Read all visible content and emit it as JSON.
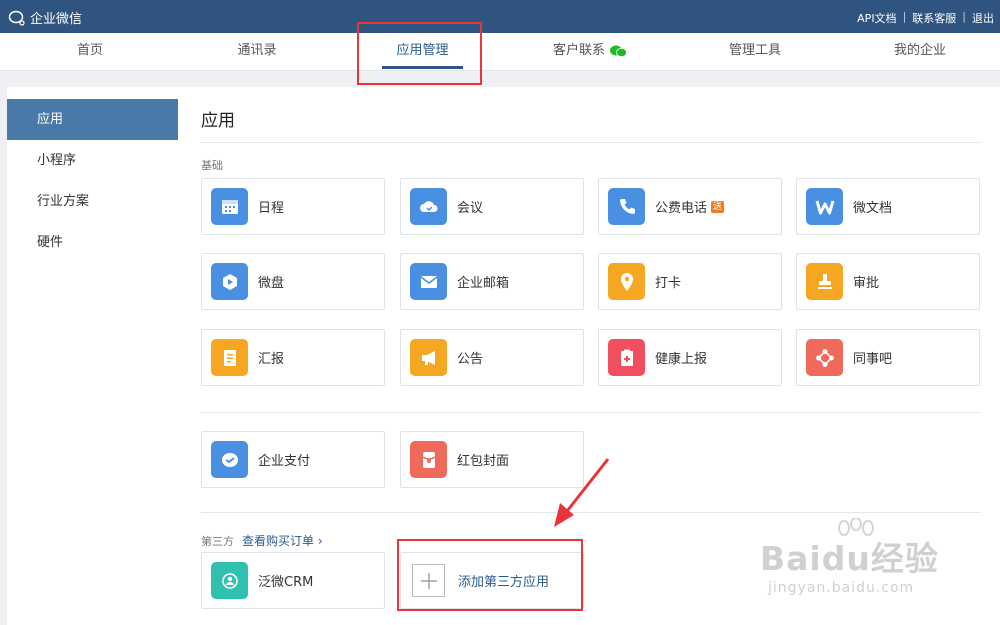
{
  "topbar": {
    "logo_text": "企业微信",
    "links": [
      "API文档",
      "联系客服",
      "退出"
    ]
  },
  "nav": {
    "tabs": [
      "首页",
      "通讯录",
      "应用管理",
      "客户联系",
      "管理工具",
      "我的企业"
    ],
    "active": "应用管理"
  },
  "sidebar": {
    "items": [
      "应用",
      "小程序",
      "行业方案",
      "硬件"
    ],
    "active": "应用"
  },
  "main": {
    "title": "应用",
    "section_basic": "基础",
    "section_third": "第三方",
    "orders_link": "查看购买订单",
    "apps": [
      {
        "name": "日程",
        "icon": "calendar-icon",
        "color": "#4a90e2"
      },
      {
        "name": "会议",
        "icon": "cloud-icon",
        "color": "#4a90e2"
      },
      {
        "name": "公费电话",
        "icon": "phone-icon",
        "color": "#4a90e2",
        "badge": "送"
      },
      {
        "name": "微文档",
        "icon": "doc-w-icon",
        "color": "#4a90e2"
      },
      {
        "name": "微盘",
        "icon": "drive-icon",
        "color": "#4a90e2"
      },
      {
        "name": "企业邮箱",
        "icon": "mail-icon",
        "color": "#4a90e2"
      },
      {
        "name": "打卡",
        "icon": "location-pin-icon",
        "color": "#f5a623"
      },
      {
        "name": "审批",
        "icon": "stamp-icon",
        "color": "#f5a623"
      },
      {
        "name": "汇报",
        "icon": "report-icon",
        "color": "#f5a623"
      },
      {
        "name": "公告",
        "icon": "megaphone-icon",
        "color": "#f5a623"
      },
      {
        "name": "健康上报",
        "icon": "health-icon",
        "color": "#f04f5f"
      },
      {
        "name": "同事吧",
        "icon": "network-icon",
        "color": "#ef6a5a"
      }
    ],
    "payment_apps": [
      {
        "name": "企业支付",
        "icon": "payment-icon",
        "color": "#4a90e2"
      },
      {
        "name": "红包封面",
        "icon": "red-packet-icon",
        "color": "#ef6a5a"
      }
    ],
    "third_party_apps": [
      {
        "name": "泛微CRM",
        "icon": "crm-icon",
        "color": "#2fc0b0"
      }
    ],
    "add_third_party": "添加第三方应用"
  },
  "watermark": {
    "main": "Baidu经验",
    "sub": "jingyan.baidu.com"
  }
}
